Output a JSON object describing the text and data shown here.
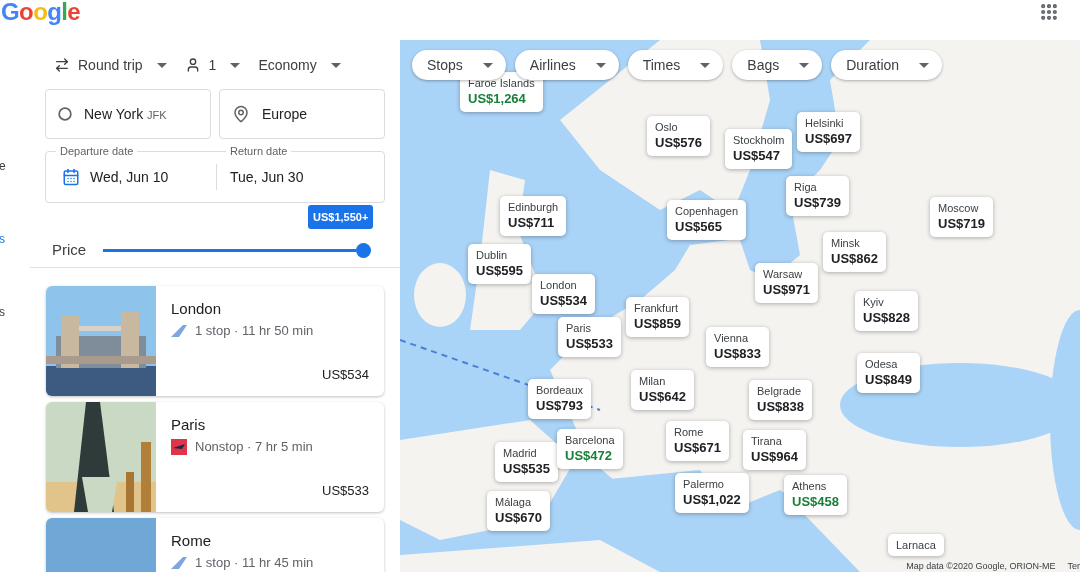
{
  "header": {
    "logo": "Google"
  },
  "sidebar_fragments": [
    {
      "text": "e",
      "selected": false
    },
    {
      "text": "s",
      "selected": true
    },
    {
      "text": "s",
      "selected": false
    }
  ],
  "trip_options": [
    {
      "label": "Round trip"
    },
    {
      "label": "1"
    },
    {
      "label": "Economy"
    }
  ],
  "origin": {
    "value": "New York",
    "code": "JFK"
  },
  "destination": {
    "value": "Europe"
  },
  "dates": {
    "departure_label": "Departure date",
    "departure": "Wed, Jun 10",
    "return_label": "Return date",
    "return": "Tue, Jun 30"
  },
  "price_filter": {
    "label": "Price",
    "tooltip": "US$1,550+",
    "level": 1
  },
  "destinations": [
    {
      "city": "London",
      "itinerary": "1 stop · 11 hr 50 min",
      "price": "US$534"
    },
    {
      "city": "Paris",
      "itinerary": "Nonstop · 7 hr 5 min",
      "price": "US$533"
    },
    {
      "city": "Rome",
      "itinerary": "1 stop · 11 hr 45 min"
    }
  ],
  "filters": [
    "Stops",
    "Airlines",
    "Times",
    "Bags",
    "Duration"
  ],
  "map_markers": [
    {
      "city": "Faroe Islands",
      "price": "US$1,264",
      "cheap": true
    },
    {
      "city": "Oslo",
      "price": "US$576",
      "cheap": false
    },
    {
      "city": "Stockholm",
      "price": "US$547",
      "cheap": false
    },
    {
      "city": "Helsinki",
      "price": "US$697",
      "cheap": false
    },
    {
      "city": "Edinburgh",
      "price": "US$711",
      "cheap": false
    },
    {
      "city": "Copenhagen",
      "price": "US$565",
      "cheap": false
    },
    {
      "city": "Riga",
      "price": "US$739",
      "cheap": false
    },
    {
      "city": "Moscow",
      "price": "US$719",
      "cheap": false
    },
    {
      "city": "Dublin",
      "price": "US$595",
      "cheap": false
    },
    {
      "city": "Minsk",
      "price": "US$862",
      "cheap": false
    },
    {
      "city": "London",
      "price": "US$534",
      "cheap": false
    },
    {
      "city": "Frankfurt",
      "price": "US$859",
      "cheap": false
    },
    {
      "city": "Warsaw",
      "price": "US$971",
      "cheap": false
    },
    {
      "city": "Kyiv",
      "price": "US$828",
      "cheap": false
    },
    {
      "city": "Paris",
      "price": "US$533",
      "cheap": false
    },
    {
      "city": "Vienna",
      "price": "US$833",
      "cheap": false
    },
    {
      "city": "Odesa",
      "price": "US$849",
      "cheap": false
    },
    {
      "city": "Bordeaux",
      "price": "US$793",
      "cheap": false
    },
    {
      "city": "Milan",
      "price": "US$642",
      "cheap": false
    },
    {
      "city": "Belgrade",
      "price": "US$838",
      "cheap": false
    },
    {
      "city": "Rome",
      "price": "US$671",
      "cheap": false
    },
    {
      "city": "Tirana",
      "price": "US$964",
      "cheap": false
    },
    {
      "city": "Madrid",
      "price": "US$535",
      "cheap": false
    },
    {
      "city": "Barcelona",
      "price": "US$472",
      "cheap": true
    },
    {
      "city": "Palermo",
      "price": "US$1,022",
      "cheap": false
    },
    {
      "city": "Athens",
      "price": "US$458",
      "cheap": true
    },
    {
      "city": "Málaga",
      "price": "US$670",
      "cheap": false
    },
    {
      "city": "Larnaca"
    }
  ],
  "map_attribution": "Map data ©2020 Google, ORION-ME",
  "map_terms": "Ter"
}
